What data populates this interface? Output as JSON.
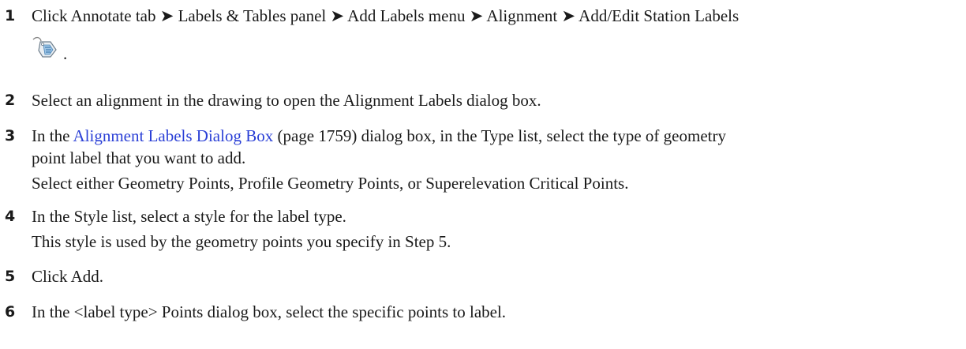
{
  "steps": [
    {
      "num": "1",
      "line1": "Click Annotate tab ➤ Labels & Tables panel ➤ Add Labels menu ➤ Alignment ➤ Add/Edit Station Labels",
      "period": ".",
      "icon": "label-tag-icon"
    },
    {
      "num": "2",
      "line1": "Select an alignment in the drawing to open the Alignment Labels dialog box."
    },
    {
      "num": "3",
      "pre": "In the ",
      "link": "Alignment Labels Dialog Box",
      "post": " (page 1759) dialog box, in the Type list, select the type of geometry",
      "line2": "point label that you want to add.",
      "line3": "Select either Geometry Points, Profile Geometry Points, or Superelevation Critical Points."
    },
    {
      "num": "4",
      "line1": "In the Style list, select a style for the label type.",
      "line2": "This style is used by the geometry points you specify in Step 5."
    },
    {
      "num": "5",
      "line1": "Click Add."
    },
    {
      "num": "6",
      "line1": "In the <label type> Points dialog box, select the specific points to label."
    }
  ],
  "colors": {
    "link": "#2a3fd6",
    "text": "#1a1a1a"
  }
}
